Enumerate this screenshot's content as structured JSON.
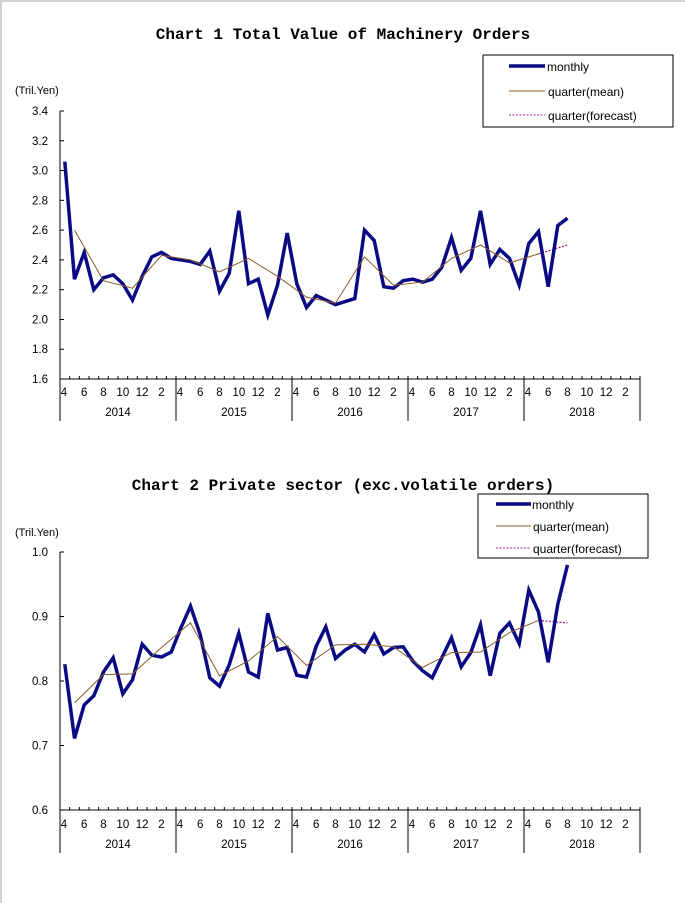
{
  "colors": {
    "monthly": "#0a0a84",
    "quarter_mean": "#8b5a2b",
    "quarter_forecast": "#a0209a",
    "axis": "#000000",
    "frame": "#cfd6cf"
  },
  "chart_data": [
    {
      "type": "line",
      "title": "Chart 1 Total Value of Machinery Orders",
      "ylabel": "(Tril.Yen)",
      "xlabel": "",
      "ylim": [
        1.6,
        3.4
      ],
      "yticks": [
        "1.6",
        "1.8",
        "2.0",
        "2.2",
        "2.4",
        "2.6",
        "2.8",
        "3.0",
        "3.2",
        "3.4"
      ],
      "ytick_values": [
        1.6,
        1.8,
        2.0,
        2.2,
        2.4,
        2.6,
        2.8,
        3.0,
        3.2,
        3.4
      ],
      "x_start": "2014-04",
      "x_months_total": 60,
      "month_tick_labels": [
        "4",
        "6",
        "8",
        "10",
        "12",
        "2"
      ],
      "fiscal_years": [
        "2014",
        "2015",
        "2016",
        "2017",
        "2018"
      ],
      "grid": false,
      "legend_position": "top-right",
      "legend": [
        "monthly",
        "quarter(mean)",
        "quarter(forecast)"
      ],
      "series": [
        {
          "name": "monthly",
          "x_index": [
            0,
            1,
            2,
            3,
            4,
            5,
            6,
            7,
            8,
            9,
            10,
            11,
            12,
            13,
            14,
            15,
            16,
            17,
            18,
            19,
            20,
            21,
            22,
            23,
            24,
            25,
            26,
            27,
            28,
            29,
            30,
            31,
            32,
            33,
            34,
            35,
            36,
            37,
            38,
            39,
            40,
            41,
            42,
            43,
            44,
            45,
            46,
            47,
            48,
            49,
            50,
            51,
            52
          ],
          "values": [
            3.06,
            2.27,
            2.45,
            2.2,
            2.28,
            2.3,
            2.24,
            2.13,
            2.29,
            2.42,
            2.45,
            2.41,
            2.4,
            2.39,
            2.37,
            2.46,
            2.19,
            2.31,
            2.73,
            2.24,
            2.27,
            2.03,
            2.23,
            2.58,
            2.24,
            2.08,
            2.16,
            2.13,
            2.1,
            2.12,
            2.14,
            2.6,
            2.53,
            2.22,
            2.21,
            2.26,
            2.27,
            2.25,
            2.27,
            2.35,
            2.55,
            2.33,
            2.41,
            2.73,
            2.37,
            2.47,
            2.41,
            2.23,
            2.51,
            2.59,
            2.22,
            2.63,
            2.68
          ]
        },
        {
          "name": "quarter(mean)",
          "x_index": [
            1,
            4,
            7,
            10,
            13,
            16,
            19,
            22,
            25,
            28,
            31,
            34,
            37,
            40,
            43,
            46,
            49
          ],
          "values": [
            2.6,
            2.26,
            2.21,
            2.43,
            2.4,
            2.32,
            2.41,
            2.29,
            2.15,
            2.11,
            2.42,
            2.23,
            2.25,
            2.41,
            2.5,
            2.38,
            2.44
          ]
        },
        {
          "name": "quarter(forecast)",
          "x_index": [
            49,
            52
          ],
          "values": [
            2.44,
            2.5
          ]
        }
      ]
    },
    {
      "type": "line",
      "title": "Chart 2 Private sector (exc.volatile orders)",
      "ylabel": "(Tril.Yen)",
      "xlabel": "",
      "ylim": [
        0.6,
        1.0
      ],
      "yticks": [
        "0.6",
        "0.7",
        "0.8",
        "0.9",
        "1.0"
      ],
      "ytick_values": [
        0.6,
        0.7,
        0.8,
        0.9,
        1.0
      ],
      "x_start": "2014-04",
      "x_months_total": 60,
      "month_tick_labels": [
        "4",
        "6",
        "8",
        "10",
        "12",
        "2"
      ],
      "fiscal_years": [
        "2014",
        "2015",
        "2016",
        "2017",
        "2018"
      ],
      "grid": false,
      "legend_position": "top-right",
      "legend": [
        "monthly",
        "quarter(mean)",
        "quarter(forecast)"
      ],
      "series": [
        {
          "name": "monthly",
          "x_index": [
            0,
            1,
            2,
            3,
            4,
            5,
            6,
            7,
            8,
            9,
            10,
            11,
            12,
            13,
            14,
            15,
            16,
            17,
            18,
            19,
            20,
            21,
            22,
            23,
            24,
            25,
            26,
            27,
            28,
            29,
            30,
            31,
            32,
            33,
            34,
            35,
            36,
            37,
            38,
            39,
            40,
            41,
            42,
            43,
            44,
            45,
            46,
            47,
            48,
            49,
            50,
            51,
            52
          ],
          "values": [
            0.826,
            0.711,
            0.763,
            0.777,
            0.814,
            0.836,
            0.78,
            0.802,
            0.857,
            0.84,
            0.837,
            0.845,
            0.882,
            0.916,
            0.872,
            0.805,
            0.792,
            0.825,
            0.874,
            0.814,
            0.806,
            0.905,
            0.848,
            0.852,
            0.809,
            0.806,
            0.854,
            0.884,
            0.835,
            0.848,
            0.857,
            0.845,
            0.872,
            0.842,
            0.852,
            0.853,
            0.831,
            0.816,
            0.805,
            0.836,
            0.867,
            0.822,
            0.844,
            0.887,
            0.808,
            0.874,
            0.89,
            0.858,
            0.941,
            0.907,
            0.829,
            0.919,
            0.98
          ]
        },
        {
          "name": "quarter(mean)",
          "x_index": [
            1,
            4,
            7,
            10,
            13,
            16,
            19,
            22,
            25,
            28,
            31,
            34,
            37,
            40,
            43,
            46,
            49
          ],
          "values": [
            0.766,
            0.81,
            0.811,
            0.852,
            0.89,
            0.808,
            0.831,
            0.869,
            0.824,
            0.856,
            0.857,
            0.853,
            0.821,
            0.844,
            0.845,
            0.875,
            0.894
          ]
        },
        {
          "name": "quarter(forecast)",
          "x_index": [
            49,
            52
          ],
          "values": [
            0.894,
            0.89
          ]
        }
      ]
    }
  ]
}
